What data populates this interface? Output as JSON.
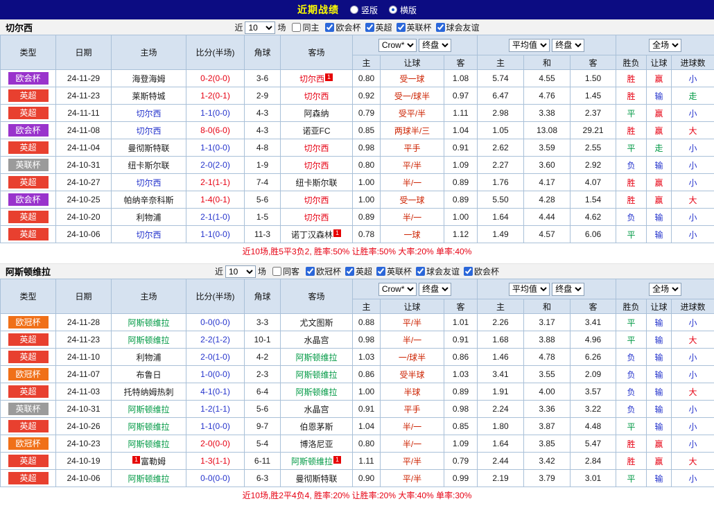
{
  "topbar": {
    "title": "近期战绩",
    "radios": [
      {
        "label": "竖版",
        "selected": false
      },
      {
        "label": "横版",
        "selected": true
      }
    ]
  },
  "table_header": {
    "type": "类型",
    "date": "日期",
    "home": "主场",
    "score": "比分(半场)",
    "corner": "角球",
    "away": "客场",
    "book_select": "Crow*",
    "final_select": "终盘",
    "avg_select": "平均值",
    "scope_select": "全场",
    "ah_home": "主",
    "ah_line": "让球",
    "ah_away": "客",
    "eu_home": "主",
    "eu_draw": "和",
    "eu_away": "客",
    "res_wdl": "胜负",
    "res_ah": "让球",
    "res_goals": "进球数"
  },
  "colors": {
    "red": "#e60012",
    "blue": "#2433cc",
    "green": "#009944",
    "black": "#1a1a1a",
    "handicap": "#cc2200"
  },
  "badge_colors": {
    "欧会杯": "#9933cc",
    "英超": "#e8402f",
    "英联杯": "#9b9b9b",
    "欧冠杯": "#f07018"
  },
  "sections": [
    {
      "team": "切尔西",
      "filter": {
        "near": "近",
        "count": "10",
        "unit": "场",
        "same_label": "同主",
        "same_checked": false,
        "leagues": [
          {
            "label": "欧会杯",
            "checked": true
          },
          {
            "label": "英超",
            "checked": true
          },
          {
            "label": "英联杯",
            "checked": true
          },
          {
            "label": "球会友谊",
            "checked": true
          }
        ]
      },
      "rows": [
        {
          "type": "欧会杯",
          "date": "24-11-29",
          "home": "海登海姆",
          "home_color": "black",
          "score": "0-2(0-0)",
          "score_color": "red",
          "corner": "3-6",
          "away": "切尔西",
          "away_color": "red",
          "away_badge_right": "1",
          "ah": [
            "0.80",
            "受一球",
            "1.08"
          ],
          "eu": [
            "5.74",
            "4.55",
            "1.50"
          ],
          "res": [
            [
              "胜",
              "red"
            ],
            [
              "赢",
              "red"
            ],
            [
              "小",
              "blue"
            ]
          ]
        },
        {
          "type": "英超",
          "date": "24-11-23",
          "home": "莱斯特城",
          "home_color": "black",
          "score": "1-2(0-1)",
          "score_color": "red",
          "corner": "2-9",
          "away": "切尔西",
          "away_color": "red",
          "ah": [
            "0.92",
            "受一/球半",
            "0.97"
          ],
          "eu": [
            "6.47",
            "4.76",
            "1.45"
          ],
          "res": [
            [
              "胜",
              "red"
            ],
            [
              "输",
              "blue"
            ],
            [
              "走",
              "green"
            ]
          ]
        },
        {
          "type": "英超",
          "date": "24-11-11",
          "home": "切尔西",
          "home_color": "blue",
          "score": "1-1(0-0)",
          "score_color": "blue",
          "corner": "4-3",
          "away": "阿森纳",
          "away_color": "black",
          "ah": [
            "0.79",
            "受平/半",
            "1.11"
          ],
          "eu": [
            "2.98",
            "3.38",
            "2.37"
          ],
          "res": [
            [
              "平",
              "green"
            ],
            [
              "赢",
              "red"
            ],
            [
              "小",
              "blue"
            ]
          ]
        },
        {
          "type": "欧会杯",
          "date": "24-11-08",
          "home": "切尔西",
          "home_color": "blue",
          "score": "8-0(6-0)",
          "score_color": "red",
          "corner": "4-3",
          "away": "诺亚FC",
          "away_color": "black",
          "ah": [
            "0.85",
            "两球半/三",
            "1.04"
          ],
          "eu": [
            "1.05",
            "13.08",
            "29.21"
          ],
          "res": [
            [
              "胜",
              "red"
            ],
            [
              "赢",
              "red"
            ],
            [
              "大",
              "red"
            ]
          ]
        },
        {
          "type": "英超",
          "date": "24-11-04",
          "home": "曼彻斯特联",
          "home_color": "black",
          "score": "1-1(0-0)",
          "score_color": "blue",
          "corner": "4-8",
          "away": "切尔西",
          "away_color": "red",
          "ah": [
            "0.98",
            "平手",
            "0.91"
          ],
          "eu": [
            "2.62",
            "3.59",
            "2.55"
          ],
          "res": [
            [
              "平",
              "green"
            ],
            [
              "走",
              "green"
            ],
            [
              "小",
              "blue"
            ]
          ]
        },
        {
          "type": "英联杯",
          "date": "24-10-31",
          "home": "纽卡斯尔联",
          "home_color": "black",
          "score": "2-0(2-0)",
          "score_color": "blue",
          "corner": "1-9",
          "away": "切尔西",
          "away_color": "red",
          "ah": [
            "0.80",
            "平/半",
            "1.09"
          ],
          "eu": [
            "2.27",
            "3.60",
            "2.92"
          ],
          "res": [
            [
              "负",
              "blue"
            ],
            [
              "输",
              "blue"
            ],
            [
              "小",
              "blue"
            ]
          ]
        },
        {
          "type": "英超",
          "date": "24-10-27",
          "home": "切尔西",
          "home_color": "blue",
          "score": "2-1(1-1)",
          "score_color": "red",
          "corner": "7-4",
          "away": "纽卡斯尔联",
          "away_color": "black",
          "ah": [
            "1.00",
            "半/一",
            "0.89"
          ],
          "eu": [
            "1.76",
            "4.17",
            "4.07"
          ],
          "res": [
            [
              "胜",
              "red"
            ],
            [
              "赢",
              "red"
            ],
            [
              "小",
              "blue"
            ]
          ]
        },
        {
          "type": "欧会杯",
          "date": "24-10-25",
          "home": "帕纳辛奈科斯",
          "home_color": "black",
          "score": "1-4(0-1)",
          "score_color": "red",
          "corner": "5-6",
          "away": "切尔西",
          "away_color": "red",
          "ah": [
            "1.00",
            "受一球",
            "0.89"
          ],
          "eu": [
            "5.50",
            "4.28",
            "1.54"
          ],
          "res": [
            [
              "胜",
              "red"
            ],
            [
              "赢",
              "red"
            ],
            [
              "大",
              "red"
            ]
          ]
        },
        {
          "type": "英超",
          "date": "24-10-20",
          "home": "利物浦",
          "home_color": "black",
          "score": "2-1(1-0)",
          "score_color": "blue",
          "corner": "1-5",
          "away": "切尔西",
          "away_color": "red",
          "ah": [
            "0.89",
            "半/一",
            "1.00"
          ],
          "eu": [
            "1.64",
            "4.44",
            "4.62"
          ],
          "res": [
            [
              "负",
              "blue"
            ],
            [
              "输",
              "blue"
            ],
            [
              "小",
              "blue"
            ]
          ]
        },
        {
          "type": "英超",
          "date": "24-10-06",
          "home": "切尔西",
          "home_color": "blue",
          "score": "1-1(0-0)",
          "score_color": "blue",
          "corner": "11-3",
          "away": "诺丁汉森林",
          "away_color": "black",
          "away_badge_right": "1",
          "ah": [
            "0.78",
            "一球",
            "1.12"
          ],
          "eu": [
            "1.49",
            "4.57",
            "6.06"
          ],
          "res": [
            [
              "平",
              "green"
            ],
            [
              "输",
              "blue"
            ],
            [
              "小",
              "blue"
            ]
          ]
        }
      ],
      "summary": "近10场,胜5平3负2, 胜率:50% 让胜率:50% 大率:20% 单率:40%"
    },
    {
      "team": "阿斯顿维拉",
      "filter": {
        "near": "近",
        "count": "10",
        "unit": "场",
        "same_label": "同客",
        "same_checked": false,
        "leagues": [
          {
            "label": "欧冠杯",
            "checked": true
          },
          {
            "label": "英超",
            "checked": true
          },
          {
            "label": "英联杯",
            "checked": true
          },
          {
            "label": "球会友谊",
            "checked": true
          },
          {
            "label": "欧会杯",
            "checked": true
          }
        ]
      },
      "rows": [
        {
          "type": "欧冠杯",
          "date": "24-11-28",
          "home": "阿斯顿维拉",
          "home_color": "green",
          "score": "0-0(0-0)",
          "score_color": "blue",
          "corner": "3-3",
          "away": "尤文图斯",
          "away_color": "black",
          "ah": [
            "0.88",
            "平/半",
            "1.01"
          ],
          "eu": [
            "2.26",
            "3.17",
            "3.41"
          ],
          "res": [
            [
              "平",
              "green"
            ],
            [
              "输",
              "blue"
            ],
            [
              "小",
              "blue"
            ]
          ]
        },
        {
          "type": "英超",
          "date": "24-11-23",
          "home": "阿斯顿维拉",
          "home_color": "green",
          "score": "2-2(1-2)",
          "score_color": "blue",
          "corner": "10-1",
          "away": "水晶宫",
          "away_color": "black",
          "ah": [
            "0.98",
            "半/一",
            "0.91"
          ],
          "eu": [
            "1.68",
            "3.88",
            "4.96"
          ],
          "res": [
            [
              "平",
              "green"
            ],
            [
              "输",
              "blue"
            ],
            [
              "大",
              "red"
            ]
          ]
        },
        {
          "type": "英超",
          "date": "24-11-10",
          "home": "利物浦",
          "home_color": "black",
          "score": "2-0(1-0)",
          "score_color": "blue",
          "corner": "4-2",
          "away": "阿斯顿维拉",
          "away_color": "green",
          "ah": [
            "1.03",
            "一/球半",
            "0.86"
          ],
          "eu": [
            "1.46",
            "4.78",
            "6.26"
          ],
          "res": [
            [
              "负",
              "blue"
            ],
            [
              "输",
              "blue"
            ],
            [
              "小",
              "blue"
            ]
          ]
        },
        {
          "type": "欧冠杯",
          "date": "24-11-07",
          "home": "布鲁日",
          "home_color": "black",
          "score": "1-0(0-0)",
          "score_color": "blue",
          "corner": "2-3",
          "away": "阿斯顿维拉",
          "away_color": "green",
          "ah": [
            "0.86",
            "受半球",
            "1.03"
          ],
          "eu": [
            "3.41",
            "3.55",
            "2.09"
          ],
          "res": [
            [
              "负",
              "blue"
            ],
            [
              "输",
              "blue"
            ],
            [
              "小",
              "blue"
            ]
          ]
        },
        {
          "type": "英超",
          "date": "24-11-03",
          "home": "托特纳姆热刺",
          "home_color": "black",
          "score": "4-1(0-1)",
          "score_color": "blue",
          "corner": "6-4",
          "away": "阿斯顿维拉",
          "away_color": "green",
          "ah": [
            "1.00",
            "半球",
            "0.89"
          ],
          "eu": [
            "1.91",
            "4.00",
            "3.57"
          ],
          "res": [
            [
              "负",
              "blue"
            ],
            [
              "输",
              "blue"
            ],
            [
              "大",
              "red"
            ]
          ]
        },
        {
          "type": "英联杯",
          "date": "24-10-31",
          "home": "阿斯顿维拉",
          "home_color": "green",
          "score": "1-2(1-1)",
          "score_color": "blue",
          "corner": "5-6",
          "away": "水晶宫",
          "away_color": "black",
          "ah": [
            "0.91",
            "平手",
            "0.98"
          ],
          "eu": [
            "2.24",
            "3.36",
            "3.22"
          ],
          "res": [
            [
              "负",
              "blue"
            ],
            [
              "输",
              "blue"
            ],
            [
              "小",
              "blue"
            ]
          ]
        },
        {
          "type": "英超",
          "date": "24-10-26",
          "home": "阿斯顿维拉",
          "home_color": "green",
          "score": "1-1(0-0)",
          "score_color": "blue",
          "corner": "9-7",
          "away": "伯恩茅斯",
          "away_color": "black",
          "ah": [
            "1.04",
            "半/一",
            "0.85"
          ],
          "eu": [
            "1.80",
            "3.87",
            "4.48"
          ],
          "res": [
            [
              "平",
              "green"
            ],
            [
              "输",
              "blue"
            ],
            [
              "小",
              "blue"
            ]
          ]
        },
        {
          "type": "欧冠杯",
          "date": "24-10-23",
          "home": "阿斯顿维拉",
          "home_color": "green",
          "score": "2-0(0-0)",
          "score_color": "red",
          "corner": "5-4",
          "away": "博洛尼亚",
          "away_color": "black",
          "ah": [
            "0.80",
            "半/一",
            "1.09"
          ],
          "eu": [
            "1.64",
            "3.85",
            "5.47"
          ],
          "res": [
            [
              "胜",
              "red"
            ],
            [
              "赢",
              "red"
            ],
            [
              "小",
              "blue"
            ]
          ]
        },
        {
          "type": "英超",
          "date": "24-10-19",
          "home": "富勒姆",
          "home_color": "black",
          "home_badge_left": "1",
          "score": "1-3(1-1)",
          "score_color": "red",
          "corner": "6-11",
          "away": "阿斯顿维拉",
          "away_color": "green",
          "away_badge_right": "1",
          "ah": [
            "1.11",
            "平/半",
            "0.79"
          ],
          "eu": [
            "2.44",
            "3.42",
            "2.84"
          ],
          "res": [
            [
              "胜",
              "red"
            ],
            [
              "赢",
              "red"
            ],
            [
              "大",
              "red"
            ]
          ]
        },
        {
          "type": "英超",
          "date": "24-10-06",
          "home": "阿斯顿维拉",
          "home_color": "green",
          "score": "0-0(0-0)",
          "score_color": "blue",
          "corner": "6-3",
          "away": "曼彻斯特联",
          "away_color": "black",
          "ah": [
            "0.90",
            "平/半",
            "0.99"
          ],
          "eu": [
            "2.19",
            "3.79",
            "3.01"
          ],
          "res": [
            [
              "平",
              "green"
            ],
            [
              "输",
              "blue"
            ],
            [
              "小",
              "blue"
            ]
          ]
        }
      ],
      "summary": "近10场,胜2平4负4, 胜率:20% 让胜率:20% 大率:40% 单率:30%"
    }
  ]
}
